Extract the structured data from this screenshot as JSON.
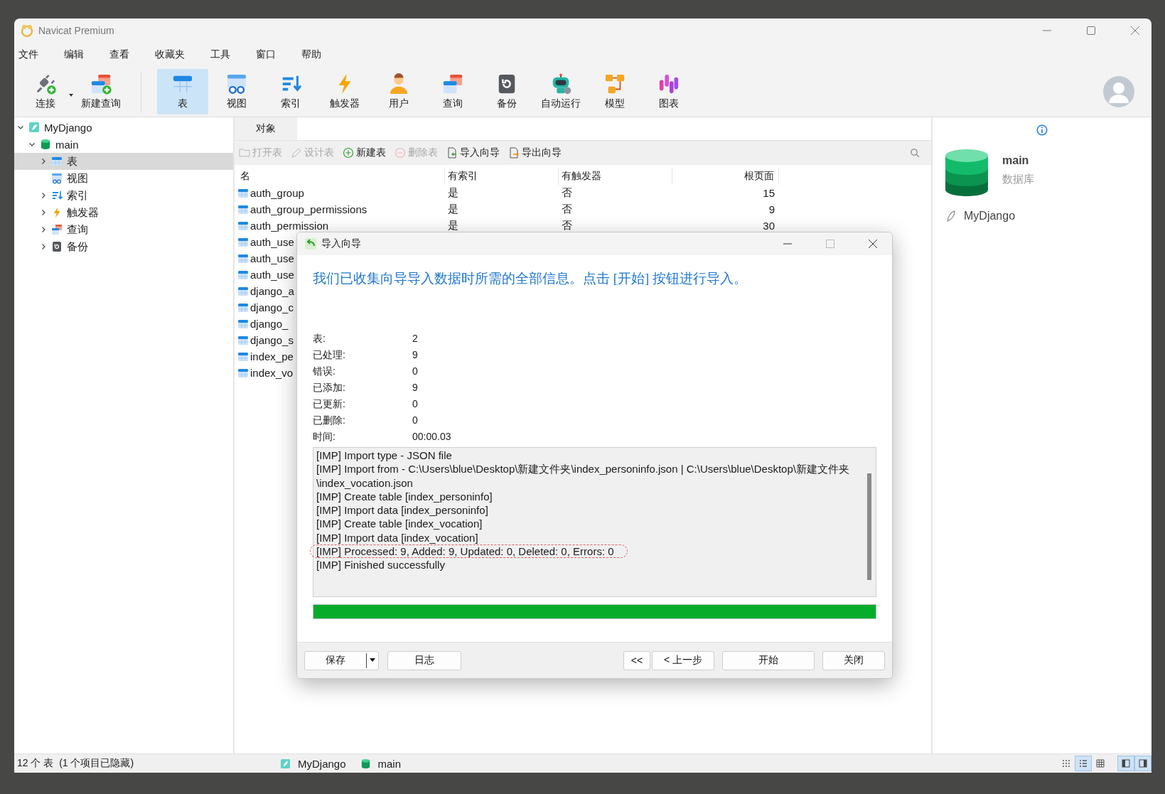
{
  "window": {
    "title": "Navicat Premium"
  },
  "menu": [
    "文件",
    "编辑",
    "查看",
    "收藏夹",
    "工具",
    "窗口",
    "帮助"
  ],
  "toolbar": [
    {
      "label": "连接",
      "kind": "connect",
      "selected": false
    },
    {
      "label": "新建查询",
      "kind": "newquery",
      "selected": false
    },
    {
      "label": "表",
      "kind": "table",
      "selected": true
    },
    {
      "label": "视图",
      "kind": "view",
      "selected": false
    },
    {
      "label": "索引",
      "kind": "index",
      "selected": false
    },
    {
      "label": "触发器",
      "kind": "trigger",
      "selected": false
    },
    {
      "label": "用户",
      "kind": "user",
      "selected": false
    },
    {
      "label": "查询",
      "kind": "query",
      "selected": false
    },
    {
      "label": "备份",
      "kind": "backup",
      "selected": false
    },
    {
      "label": "自动运行",
      "kind": "robot",
      "selected": false
    },
    {
      "label": "模型",
      "kind": "model",
      "selected": false
    },
    {
      "label": "图表",
      "kind": "chart",
      "selected": false
    }
  ],
  "sidebar": {
    "tree": [
      {
        "label": "MyDjango",
        "kind": "connection",
        "expanded": true,
        "selected": false,
        "children": [
          {
            "label": "main",
            "kind": "database",
            "expanded": true,
            "selected": false,
            "children": [
              {
                "label": "表",
                "kind": "table",
                "expanded": false,
                "selected": true
              },
              {
                "label": "视图",
                "kind": "view",
                "selected": false
              },
              {
                "label": "索引",
                "kind": "index",
                "expanded": false,
                "selected": false
              },
              {
                "label": "触发器",
                "kind": "trigger",
                "expanded": false,
                "selected": false
              },
              {
                "label": "查询",
                "kind": "query",
                "expanded": false,
                "selected": false
              },
              {
                "label": "备份",
                "kind": "backup",
                "expanded": false,
                "selected": false
              }
            ]
          }
        ]
      }
    ]
  },
  "tabs": [
    {
      "label": "对象",
      "selected": true
    }
  ],
  "object_toolbar": [
    {
      "label": "打开表",
      "kind": "open",
      "disabled": true
    },
    {
      "label": "设计表",
      "kind": "design",
      "disabled": true
    },
    {
      "label": "新建表",
      "kind": "new",
      "disabled": false
    },
    {
      "label": "删除表",
      "kind": "delete",
      "disabled": true
    },
    {
      "label": "导入向导",
      "kind": "import",
      "disabled": false
    },
    {
      "label": "导出向导",
      "kind": "export",
      "disabled": false
    }
  ],
  "table": {
    "columns": [
      "名",
      "有索引",
      "有触发器",
      "根页面"
    ],
    "rows": [
      [
        "auth_group",
        "是",
        "否",
        "15"
      ],
      [
        "auth_group_permissions",
        "是",
        "否",
        "9"
      ],
      [
        "auth_permission",
        "是",
        "否",
        "30"
      ],
      [
        "auth_use"
      ],
      [
        "auth_use"
      ],
      [
        "auth_use"
      ],
      [
        "django_a"
      ],
      [
        "django_c"
      ],
      [
        "django_"
      ],
      [
        "django_s"
      ],
      [
        "index_pe"
      ],
      [
        "index_vo"
      ]
    ]
  },
  "info_panel": {
    "name": "main",
    "type": "数据库",
    "connection": "MyDjango"
  },
  "dialog": {
    "title": "导入向导",
    "message": "我们已收集向导导入数据时所需的全部信息。点击 [开始] 按钮进行导入。",
    "stats": [
      {
        "label": "表:",
        "value": "2"
      },
      {
        "label": "已处理:",
        "value": "9"
      },
      {
        "label": "错误:",
        "value": "0"
      },
      {
        "label": "已添加:",
        "value": "9"
      },
      {
        "label": "已更新:",
        "value": "0"
      },
      {
        "label": "已删除:",
        "value": "0"
      },
      {
        "label": "时间:",
        "value": "00:00.03"
      }
    ],
    "log": [
      {
        "text": "[IMP] Import type - JSON file",
        "highlighted": false
      },
      {
        "text": "[IMP] Import from - C:\\Users\\blue\\Desktop\\新建文件夹\\index_personinfo.json | C:\\Users\\blue\\Desktop\\新建文件夹\\index_vocation.json",
        "highlighted": false
      },
      {
        "text": "[IMP] Create table [index_personinfo]",
        "highlighted": false
      },
      {
        "text": "[IMP] Import data [index_personinfo]",
        "highlighted": false
      },
      {
        "text": "[IMP] Create table [index_vocation]",
        "highlighted": false
      },
      {
        "text": "[IMP] Import data [index_vocation]",
        "highlighted": false
      },
      {
        "text": "[IMP] Processed: 9, Added: 9, Updated: 0, Deleted: 0, Errors: 0",
        "highlighted": true
      },
      {
        "text": "[IMP] Finished successfully",
        "highlighted": false
      }
    ],
    "progress": {
      "level": 1
    },
    "buttons_left": [
      {
        "label": "保存",
        "dropdown": true
      },
      {
        "label": "日志",
        "dropdown": false
      }
    ],
    "buttons_right": [
      {
        "label": "<<",
        "kind": "small"
      },
      {
        "label": "< 上一步",
        "kind": "medium"
      },
      {
        "label": "开始",
        "kind": "wide"
      },
      {
        "label": "关闭",
        "kind": "medium"
      }
    ]
  },
  "status_bar": {
    "summary": "12 个 表  (1 个项目已隐藏)",
    "connection": "MyDjango",
    "database": "main",
    "view_modes": [
      {
        "kind": "grid",
        "selected": false
      },
      {
        "kind": "list",
        "selected": true
      },
      {
        "kind": "detail",
        "selected": false
      }
    ],
    "panels": [
      {
        "kind": "left",
        "selected": true
      },
      {
        "kind": "right",
        "selected": true
      }
    ]
  }
}
